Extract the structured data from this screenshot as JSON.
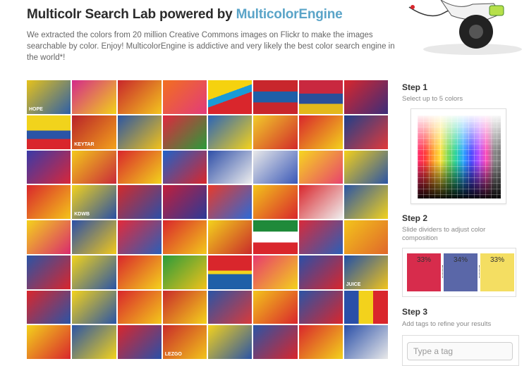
{
  "header": {
    "title_prefix": "Multicolr Search Lab powered by ",
    "title_brand": "MulticolorEngine",
    "description": "We extracted the colors from 20 million Creative Commons images on Flickr to make the images searchable by color. Enjoy! MulticolorEngine is addictive and very likely the best color search engine in the world*!"
  },
  "colors": {
    "brand": "#5aa4c8",
    "swatch_red": "#d72c4c",
    "swatch_blue": "#5a67a8",
    "swatch_yellow": "#f4de62"
  },
  "grid": {
    "tiles": [
      {
        "bg": "linear-gradient(135deg,#e6c21b,#2d5fa8)",
        "text": "HOPE"
      },
      {
        "bg": "linear-gradient(135deg,#d42a8a,#f2d21a)",
        "text": ""
      },
      {
        "bg": "linear-gradient(135deg,#c8262c,#f3c51e)",
        "text": ""
      },
      {
        "bg": "linear-gradient(135deg,#f26f1f,#e23b7a)",
        "text": ""
      },
      {
        "bg": "linear-gradient(160deg,#f5d20f 40%,#1a9bd7 40%,#1a9bd7 55%,#d9262c 55%)",
        "text": ""
      },
      {
        "bg": "linear-gradient(180deg,#c8262c 33%,#1f5fa8 33%,#1f5fa8 66%,#c8262c 66%)",
        "text": ""
      },
      {
        "bg": "linear-gradient(180deg,#c9283f 40%,#2a4f9a 40%,#2a4f9a 70%,#e3b81c 70%)",
        "text": ""
      },
      {
        "bg": "linear-gradient(135deg,#d9262c,#3b2d7a)",
        "text": ""
      },
      {
        "bg": "linear-gradient(180deg,#f1d31c 45%,#2a54a6 45%,#2a54a6 70%,#d9262c 70%)",
        "text": ""
      },
      {
        "bg": "linear-gradient(135deg,#b8222a,#f3a21b)",
        "text": "KEYTAR"
      },
      {
        "bg": "linear-gradient(135deg,#2b55a3,#f2c21a)",
        "text": ""
      },
      {
        "bg": "linear-gradient(135deg,#e0273e,#2a9b3a)",
        "text": ""
      },
      {
        "bg": "linear-gradient(135deg,#2a64b8,#f4d21c)",
        "text": ""
      },
      {
        "bg": "linear-gradient(135deg,#f1cc2a,#d22a2a)",
        "text": ""
      },
      {
        "bg": "linear-gradient(135deg,#d9262c,#f3d21c)",
        "text": ""
      },
      {
        "bg": "linear-gradient(135deg,#1f3f8a,#e13a3a)",
        "text": ""
      },
      {
        "bg": "linear-gradient(135deg,#3a3aa8,#d8273a)",
        "text": ""
      },
      {
        "bg": "linear-gradient(135deg,#f3c81b,#c92a3a)",
        "text": ""
      },
      {
        "bg": "linear-gradient(135deg,#d9262c,#f2d31c)",
        "text": ""
      },
      {
        "bg": "linear-gradient(135deg,#1f62c8,#d9262c)",
        "text": ""
      },
      {
        "bg": "linear-gradient(135deg,#2f4fa8,#ededed)",
        "text": ""
      },
      {
        "bg": "linear-gradient(135deg,#e9e9e9,#3a58b8)",
        "text": ""
      },
      {
        "bg": "linear-gradient(135deg,#f6d61f,#e8436e)",
        "text": ""
      },
      {
        "bg": "linear-gradient(135deg,#f4d01a,#2a54a6)",
        "text": ""
      },
      {
        "bg": "linear-gradient(135deg,#d9262c,#f4c41a)",
        "text": ""
      },
      {
        "bg": "linear-gradient(135deg,#f3d21c,#2850a5)",
        "text": "KDWB"
      },
      {
        "bg": "linear-gradient(135deg,#d32a2a,#2a4fa8)",
        "text": ""
      },
      {
        "bg": "linear-gradient(135deg,#c21e3a,#2a3a98)",
        "text": ""
      },
      {
        "bg": "linear-gradient(135deg,#e93a2a,#2a6ad8)",
        "text": ""
      },
      {
        "bg": "linear-gradient(135deg,#f2c41b,#d9262c)",
        "text": ""
      },
      {
        "bg": "linear-gradient(135deg,#d9262c,#efefef)",
        "text": ""
      },
      {
        "bg": "linear-gradient(135deg,#2a54a6,#f3d21c)",
        "text": ""
      },
      {
        "bg": "linear-gradient(135deg,#f4d21c,#d92a6e)",
        "text": ""
      },
      {
        "bg": "linear-gradient(135deg,#2a4fa8,#f2c81b)",
        "text": ""
      },
      {
        "bg": "linear-gradient(135deg,#e42a3a,#2a5fb8)",
        "text": ""
      },
      {
        "bg": "linear-gradient(135deg,#d9262c,#f3c81b)",
        "text": ""
      },
      {
        "bg": "linear-gradient(135deg,#f3d21c,#c92a2a)",
        "text": ""
      },
      {
        "bg": "linear-gradient(180deg,#1f8a3a 33%,#ffffff 33%,#ffffff 66%,#d9262c 66%)",
        "text": ""
      },
      {
        "bg": "linear-gradient(135deg,#d92a3a,#2a5fb8)",
        "text": ""
      },
      {
        "bg": "linear-gradient(135deg,#f3c41b,#e0672a)",
        "text": ""
      },
      {
        "bg": "linear-gradient(135deg,#2a54a6,#d9262c)",
        "text": ""
      },
      {
        "bg": "linear-gradient(135deg,#f1d31c,#2a54a6)",
        "text": ""
      },
      {
        "bg": "linear-gradient(135deg,#d9262c,#f4d21c)",
        "text": ""
      },
      {
        "bg": "linear-gradient(135deg,#2a9b3a,#f2c21a)",
        "text": ""
      },
      {
        "bg": "linear-gradient(180deg,#d9262c 45%,#f3d21c 45%,#f3d21c 55%,#1f5fa8 55%)",
        "text": ""
      },
      {
        "bg": "linear-gradient(135deg,#e83a6e,#f3d21c)",
        "text": ""
      },
      {
        "bg": "linear-gradient(135deg,#2a4fa8,#d9262c)",
        "text": ""
      },
      {
        "bg": "linear-gradient(135deg,#1f4fa8,#f2c41b)",
        "text": "JUICE"
      },
      {
        "bg": "linear-gradient(135deg,#d9262c,#2a54a6)",
        "text": ""
      },
      {
        "bg": "linear-gradient(135deg,#f3d21c,#2a54a6)",
        "text": ""
      },
      {
        "bg": "linear-gradient(135deg,#d9262c,#f3c81b)",
        "text": ""
      },
      {
        "bg": "linear-gradient(135deg,#c92a2a,#f4d21c)",
        "text": ""
      },
      {
        "bg": "linear-gradient(135deg,#2a54a6,#d93a3a)",
        "text": ""
      },
      {
        "bg": "linear-gradient(135deg,#f3c41b,#d9262c)",
        "text": ""
      },
      {
        "bg": "linear-gradient(135deg,#2a54a6,#d9262c)",
        "text": ""
      },
      {
        "bg": "linear-gradient(90deg,#2a4fa8 33%,#f3d21c 33%,#f3d21c 66%,#d9262c 66%)",
        "text": ""
      },
      {
        "bg": "linear-gradient(135deg,#f3d21c,#d9262c)",
        "text": ""
      },
      {
        "bg": "linear-gradient(135deg,#2a54a6,#f3d21c)",
        "text": ""
      },
      {
        "bg": "linear-gradient(135deg,#d9262c,#2a4fa8)",
        "text": ""
      },
      {
        "bg": "linear-gradient(135deg,#c92a2a,#f2c41b)",
        "text": "LEZGO"
      },
      {
        "bg": "linear-gradient(135deg,#f4d21c,#2a54a6)",
        "text": ""
      },
      {
        "bg": "linear-gradient(135deg,#2a54a6,#d9262c)",
        "text": ""
      },
      {
        "bg": "linear-gradient(135deg,#d9262c,#f3d21c)",
        "text": ""
      },
      {
        "bg": "linear-gradient(135deg,#2a4fa8,#e9e9e9)",
        "text": ""
      }
    ]
  },
  "step1": {
    "title": "Step 1",
    "subtitle": "Select up to 5 colors"
  },
  "step2": {
    "title": "Step 2",
    "subtitle_line1": "Slide dividers to adjust color",
    "subtitle_line2": "composition",
    "swatches": [
      {
        "label": "33%",
        "percent": 33,
        "color": "#d72c4c"
      },
      {
        "label": "34%",
        "percent": 34,
        "color": "#5a67a8"
      },
      {
        "label": "33%",
        "percent": 33,
        "color": "#f4de62"
      }
    ]
  },
  "step3": {
    "title": "Step 3",
    "subtitle": "Add tags to refine your results",
    "input_placeholder": "Type a tag",
    "input_value": ""
  }
}
